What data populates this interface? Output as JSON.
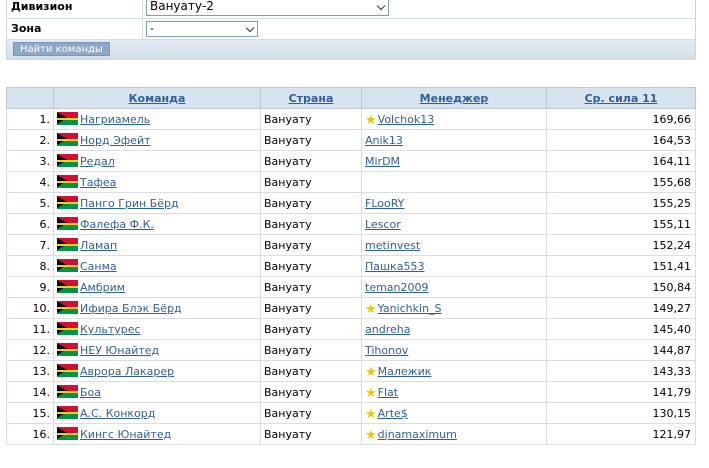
{
  "filter": {
    "division_label": "Дивизион",
    "division_value": "Вануату-2",
    "zone_label": "Зона",
    "zone_value": "-",
    "find_button": "Найти команды"
  },
  "table": {
    "headers": {
      "team": "Команда",
      "country": "Страна",
      "manager": "Менеджер",
      "power": "Ср. сила 11"
    },
    "rows": [
      {
        "rank": "1.",
        "team": "Нагриамель",
        "country": "Вануату",
        "manager": "Volchok13",
        "star": true,
        "power": "169,66"
      },
      {
        "rank": "2.",
        "team": "Норд Эфейт",
        "country": "Вануату",
        "manager": "Anik13",
        "star": false,
        "power": "164,53"
      },
      {
        "rank": "3.",
        "team": "Редал",
        "country": "Вануату",
        "manager": "MirDM",
        "star": false,
        "power": "164,11"
      },
      {
        "rank": "4.",
        "team": "Тафеа",
        "country": "Вануату",
        "manager": "",
        "star": false,
        "power": "155,68"
      },
      {
        "rank": "5.",
        "team": "Панго Грин Бёрд",
        "country": "Вануату",
        "manager": "FLooRY",
        "star": false,
        "power": "155,25"
      },
      {
        "rank": "6.",
        "team": "Фалефа Ф.К.",
        "country": "Вануату",
        "manager": "Lescor",
        "star": false,
        "power": "155,11"
      },
      {
        "rank": "7.",
        "team": "Ламап",
        "country": "Вануату",
        "manager": "metinvest",
        "star": false,
        "power": "152,24"
      },
      {
        "rank": "8.",
        "team": "Санма",
        "country": "Вануату",
        "manager": "Пашка553",
        "star": false,
        "power": "151,41"
      },
      {
        "rank": "9.",
        "team": "Амбрим",
        "country": "Вануату",
        "manager": "teman2009",
        "star": false,
        "power": "150,84"
      },
      {
        "rank": "10.",
        "team": "Ифира Блэк Бёрд",
        "country": "Вануату",
        "manager": "Yanichkin_S",
        "star": true,
        "power": "149,27"
      },
      {
        "rank": "11.",
        "team": "Культурес",
        "country": "Вануату",
        "manager": "andreha",
        "star": false,
        "power": "145,40"
      },
      {
        "rank": "12.",
        "team": "НЕУ Юнайтед",
        "country": "Вануату",
        "manager": "Tihonov",
        "star": false,
        "power": "144,87"
      },
      {
        "rank": "13.",
        "team": "Аврора Лакарер",
        "country": "Вануату",
        "manager": "Малежик",
        "star": true,
        "power": "143,33"
      },
      {
        "rank": "14.",
        "team": "Боа",
        "country": "Вануату",
        "manager": "Flat",
        "star": true,
        "power": "141,79"
      },
      {
        "rank": "15.",
        "team": "А.С. Конкорд",
        "country": "Вануату",
        "manager": "Arte$",
        "star": true,
        "power": "130,15"
      },
      {
        "rank": "16.",
        "team": "Кингс Юнайтед",
        "country": "Вануату",
        "manager": "djnamaximum",
        "star": true,
        "power": "121,97"
      }
    ]
  },
  "icons": {
    "flag": "vanuatu-flag-icon",
    "star": "star-icon"
  },
  "colors": {
    "link": "#2f5f9a",
    "header_bg": "#d7e3ee",
    "star": "#f2c500"
  }
}
